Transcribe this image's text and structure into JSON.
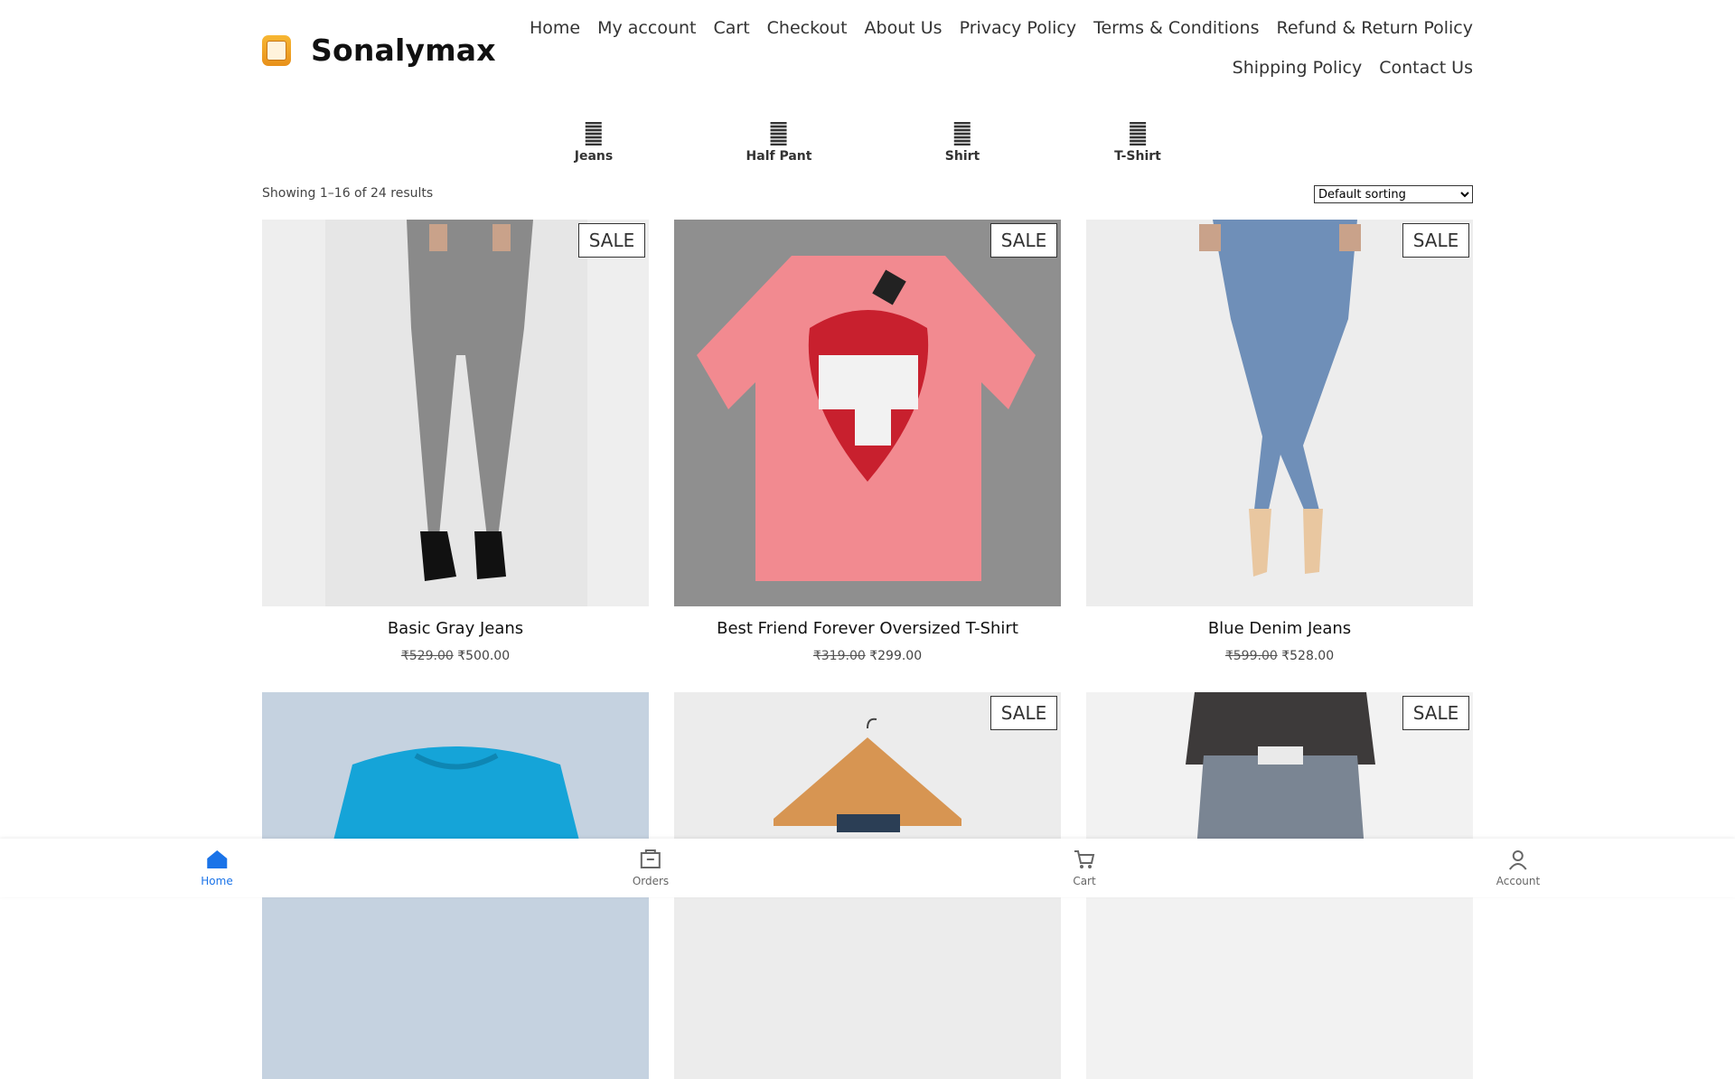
{
  "site": {
    "title": "Sonalymax"
  },
  "nav": [
    "Home",
    "My account",
    "Cart",
    "Checkout",
    "About Us",
    "Privacy Policy",
    "Terms & Conditions",
    "Refund & Return Policy",
    "Shipping Policy",
    "Contact Us"
  ],
  "categories": [
    "Jeans",
    "Half Pant",
    "Shirt",
    "T-Shirt"
  ],
  "results_text": "Showing 1–16 of 24 results",
  "sorting": {
    "selected": "Default sorting"
  },
  "products": [
    {
      "name": "Basic Gray Jeans",
      "old_price": "₹529.00",
      "price": "₹500.00",
      "sale": "SALE"
    },
    {
      "name": "Best Friend Forever Oversized T-Shirt",
      "old_price": "₹319.00",
      "price": "₹299.00",
      "sale": "SALE"
    },
    {
      "name": "Blue Denim Jeans",
      "old_price": "₹599.00",
      "price": "₹528.00",
      "sale": "SALE"
    },
    {
      "name": "",
      "old_price": "",
      "price": "",
      "sale": ""
    },
    {
      "name": "",
      "old_price": "",
      "price": "",
      "sale": "SALE"
    },
    {
      "name": "",
      "old_price": "",
      "price": "",
      "sale": "SALE"
    }
  ],
  "bottom_nav": [
    {
      "label": "Home",
      "icon": "home-icon"
    },
    {
      "label": "Orders",
      "icon": "orders-icon"
    },
    {
      "label": "Cart",
      "icon": "cart-icon"
    },
    {
      "label": "Account",
      "icon": "account-icon"
    }
  ],
  "colors": {
    "accent": "#1a73e8",
    "logo": "#f0a52a"
  }
}
